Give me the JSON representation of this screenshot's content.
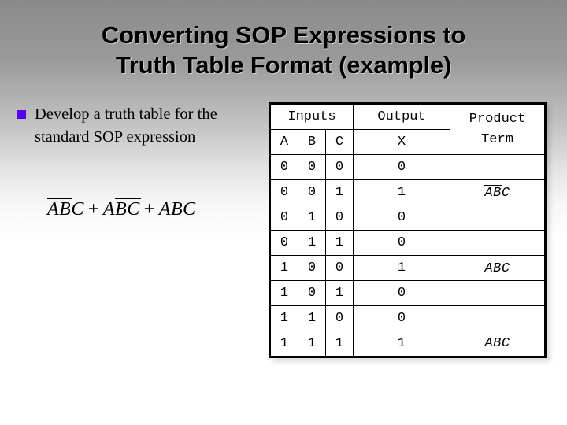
{
  "slide": {
    "title_line1": "Converting SOP Expressions to",
    "title_line2": "Truth Table Format (example)",
    "bullet_text": "Develop a truth table for the standard SOP expression",
    "bullet_marker_color": "#5500ee"
  },
  "expression": {
    "term1": {
      "a": "A",
      "a_bar": true,
      "b": "B",
      "b_bar": true,
      "c": "C",
      "c_bar": false
    },
    "term2": {
      "a": "A",
      "a_bar": false,
      "b": "B",
      "b_bar": true,
      "c": "C",
      "c_bar": true
    },
    "term3": {
      "a": "A",
      "a_bar": false,
      "b": "B",
      "b_bar": false,
      "c": "C",
      "c_bar": false
    },
    "operator": "+"
  },
  "table": {
    "group_headers": {
      "inputs": "Inputs",
      "output": "Output",
      "product_term": "Product Term"
    },
    "column_headers": [
      "A",
      "B",
      "C",
      "X"
    ],
    "colors": {
      "zero": "#2f7d32",
      "one": "#c0392b"
    },
    "rows": [
      {
        "a": "0",
        "b": "0",
        "c": "0",
        "x": "0",
        "term": "",
        "term_bars": []
      },
      {
        "a": "0",
        "b": "0",
        "c": "1",
        "x": "1",
        "term": "ABC",
        "term_bars": [
          true,
          true,
          false
        ]
      },
      {
        "a": "0",
        "b": "1",
        "c": "0",
        "x": "0",
        "term": "",
        "term_bars": []
      },
      {
        "a": "0",
        "b": "1",
        "c": "1",
        "x": "0",
        "term": "",
        "term_bars": []
      },
      {
        "a": "1",
        "b": "0",
        "c": "0",
        "x": "1",
        "term": "ABC",
        "term_bars": [
          false,
          true,
          true
        ]
      },
      {
        "a": "1",
        "b": "0",
        "c": "1",
        "x": "0",
        "term": "",
        "term_bars": []
      },
      {
        "a": "1",
        "b": "1",
        "c": "0",
        "x": "0",
        "term": "",
        "term_bars": []
      },
      {
        "a": "1",
        "b": "1",
        "c": "1",
        "x": "1",
        "term": "ABC",
        "term_bars": [
          false,
          false,
          false
        ]
      }
    ]
  }
}
